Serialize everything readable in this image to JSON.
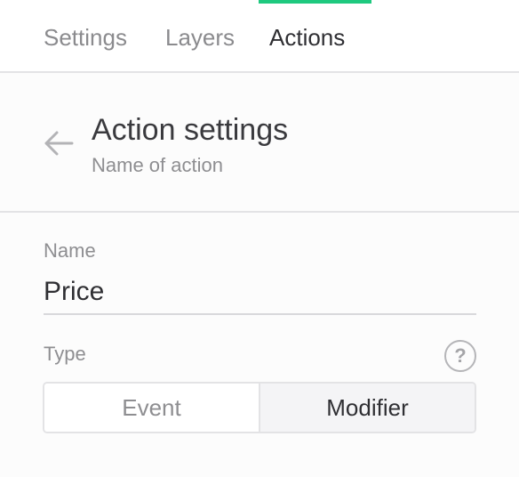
{
  "tabs": {
    "items": [
      {
        "label": "Settings",
        "active": false
      },
      {
        "label": "Layers",
        "active": false
      },
      {
        "label": "Actions",
        "active": true
      }
    ],
    "indicator_color": "#1fc97f"
  },
  "header": {
    "back_icon": "arrow-left-icon",
    "title": "Action settings",
    "subtitle": "Name of action"
  },
  "form": {
    "name": {
      "label": "Name",
      "value": "Price"
    },
    "type": {
      "label": "Type",
      "help_icon": "question-circle-icon",
      "help_glyph": "?",
      "options": [
        "Event",
        "Modifier"
      ],
      "selected": "Modifier"
    }
  }
}
